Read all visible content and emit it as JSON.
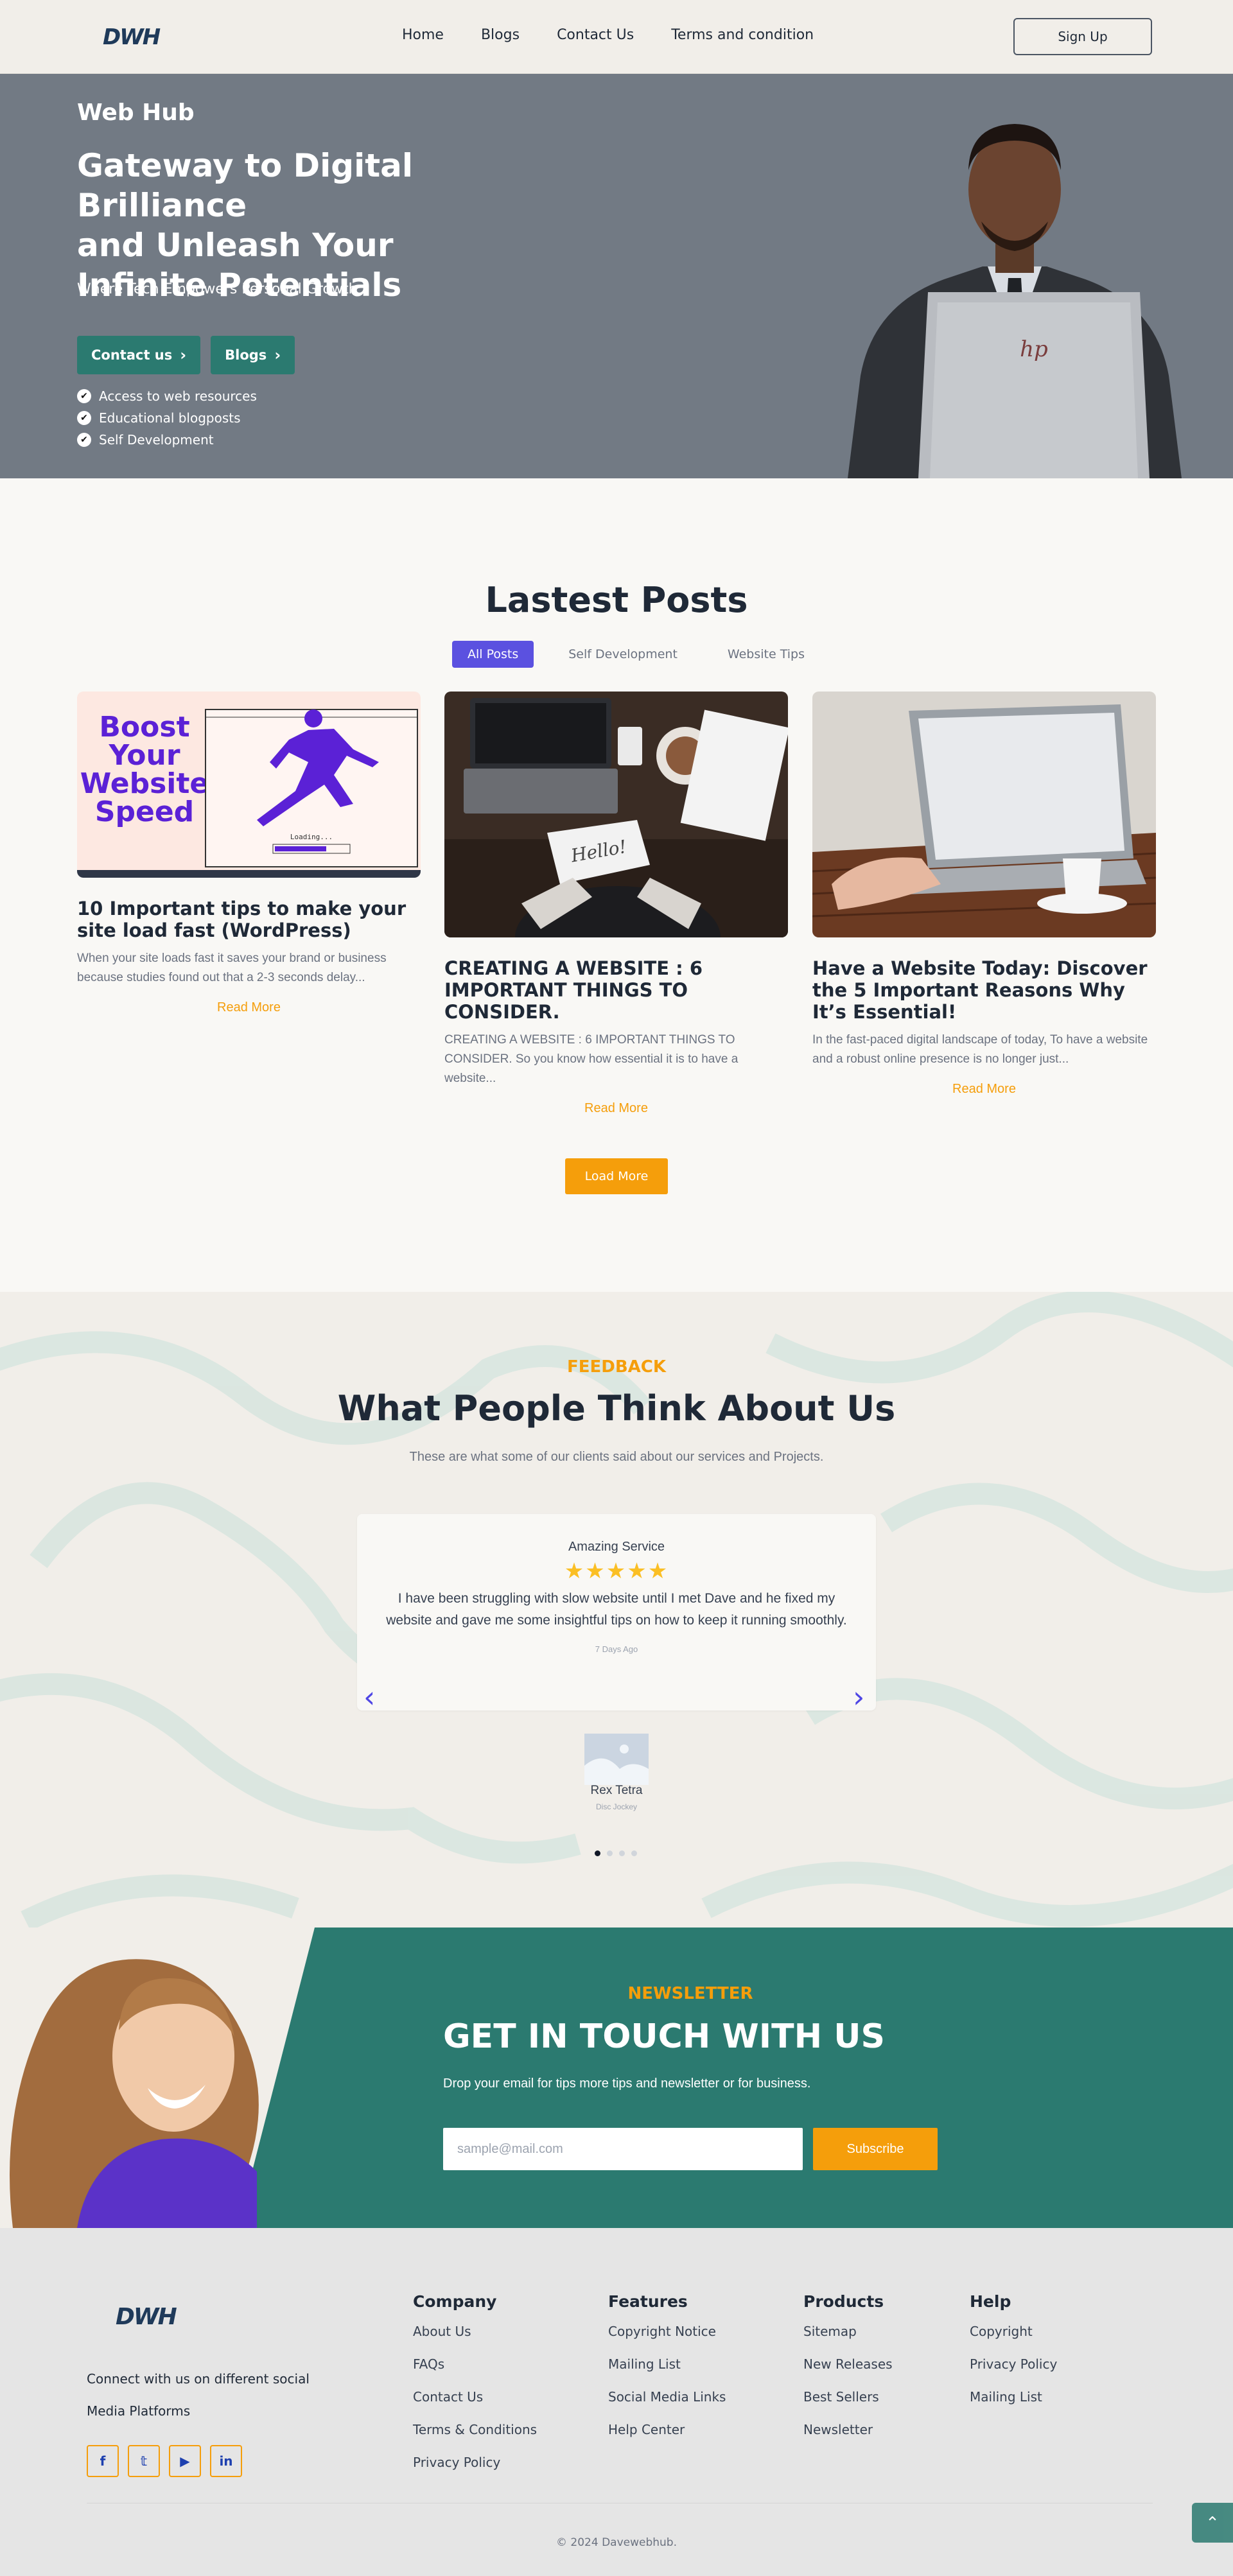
{
  "nav": {
    "logo": "DWH",
    "links": [
      "Home",
      "Blogs",
      "Contact Us",
      "Terms and condition"
    ],
    "signup": "Sign Up"
  },
  "hero": {
    "brand": "Web Hub",
    "title_line1": "Gateway to Digital Brilliance",
    "title_line2": "and Unleash Your",
    "title_line3": "Infinite Potentials",
    "subtitle": "Where Tech Empowers Personal Growth",
    "buttons": [
      "Contact us",
      "Blogs"
    ],
    "checks": [
      "Access to web resources",
      "Educational blogposts",
      "Self Development"
    ],
    "laptop_brand": "hp"
  },
  "posts": {
    "title": "Lastest Posts",
    "filters": [
      "All Posts",
      "Self Development",
      "Website Tips"
    ],
    "cards": [
      {
        "image_text": [
          "Boost",
          "Your",
          "Website",
          "Speed"
        ],
        "loading": "Loading...",
        "title": "10 Important tips to make your site load fast (WordPress)",
        "excerpt": "When your site loads fast it saves your brand or business because studies found out that a 2-3 seconds delay...",
        "more": "Read More"
      },
      {
        "image_text": [
          "Hello!"
        ],
        "title": "CREATING A WEBSITE : 6 IMPORTANT THINGS TO CONSIDER.",
        "excerpt": "CREATING A WEBSITE : 6 IMPORTANT THINGS TO CONSIDER. So you know how essential it is to have a website...",
        "more": "Read More"
      },
      {
        "title": "Have a Website Today: Discover the 5 Important Reasons Why It’s Essential!",
        "excerpt": "In the fast-paced digital landscape of today, To have a website and a robust online presence is no longer just...",
        "more": "Read More"
      }
    ],
    "load_more": "Load More"
  },
  "feedback": {
    "kicker": "FEEDBACK",
    "title": "What People Think About Us",
    "subtitle": "These are what some of our clients said about our services and Projects.",
    "testimonial": {
      "heading": "Amazing Service",
      "rating": 4.5,
      "stars": "★★★★★",
      "body": "I have been struggling with slow website until I met Dave and he fixed my website and gave me some insightful tips on how to keep it running smoothly.",
      "ago": "7 Days Ago",
      "name": "Rex Tetra",
      "role": "Disc Jockey"
    },
    "dots": 4,
    "active_dot": 0
  },
  "newsletter": {
    "kicker": "NEWSLETTER",
    "title": "GET IN TOUCH WITH US",
    "subtitle": "Drop your email for tips more tips and newsletter or for business.",
    "placeholder": "sample@mail.com",
    "button": "Subscribe"
  },
  "footer": {
    "logo": "DWH",
    "connect": "Connect with us on different social Media Platforms",
    "socials": [
      "facebook-icon",
      "twitter-icon",
      "youtube-icon",
      "linkedin-icon"
    ],
    "columns": [
      {
        "heading": "Company",
        "links": [
          "About Us",
          "FAQs",
          "Contact Us",
          "Terms & Conditions",
          "Privacy Policy"
        ]
      },
      {
        "heading": "Features",
        "links": [
          "Copyright Notice",
          "Mailing List",
          "Social Media Links",
          "Help Center"
        ]
      },
      {
        "heading": "Products",
        "links": [
          "Sitemap",
          "New Releases",
          "Best Sellers",
          "Newsletter"
        ]
      },
      {
        "heading": "Help",
        "links": [
          "Copyright",
          "Privacy Policy",
          "Mailing List"
        ]
      }
    ],
    "copyright": "© 2024  Davewebhub."
  },
  "colors": {
    "teal": "#2b7a70",
    "orange": "#f59e0b",
    "purple": "#5b51e0",
    "hero_bg": "#727a84"
  }
}
